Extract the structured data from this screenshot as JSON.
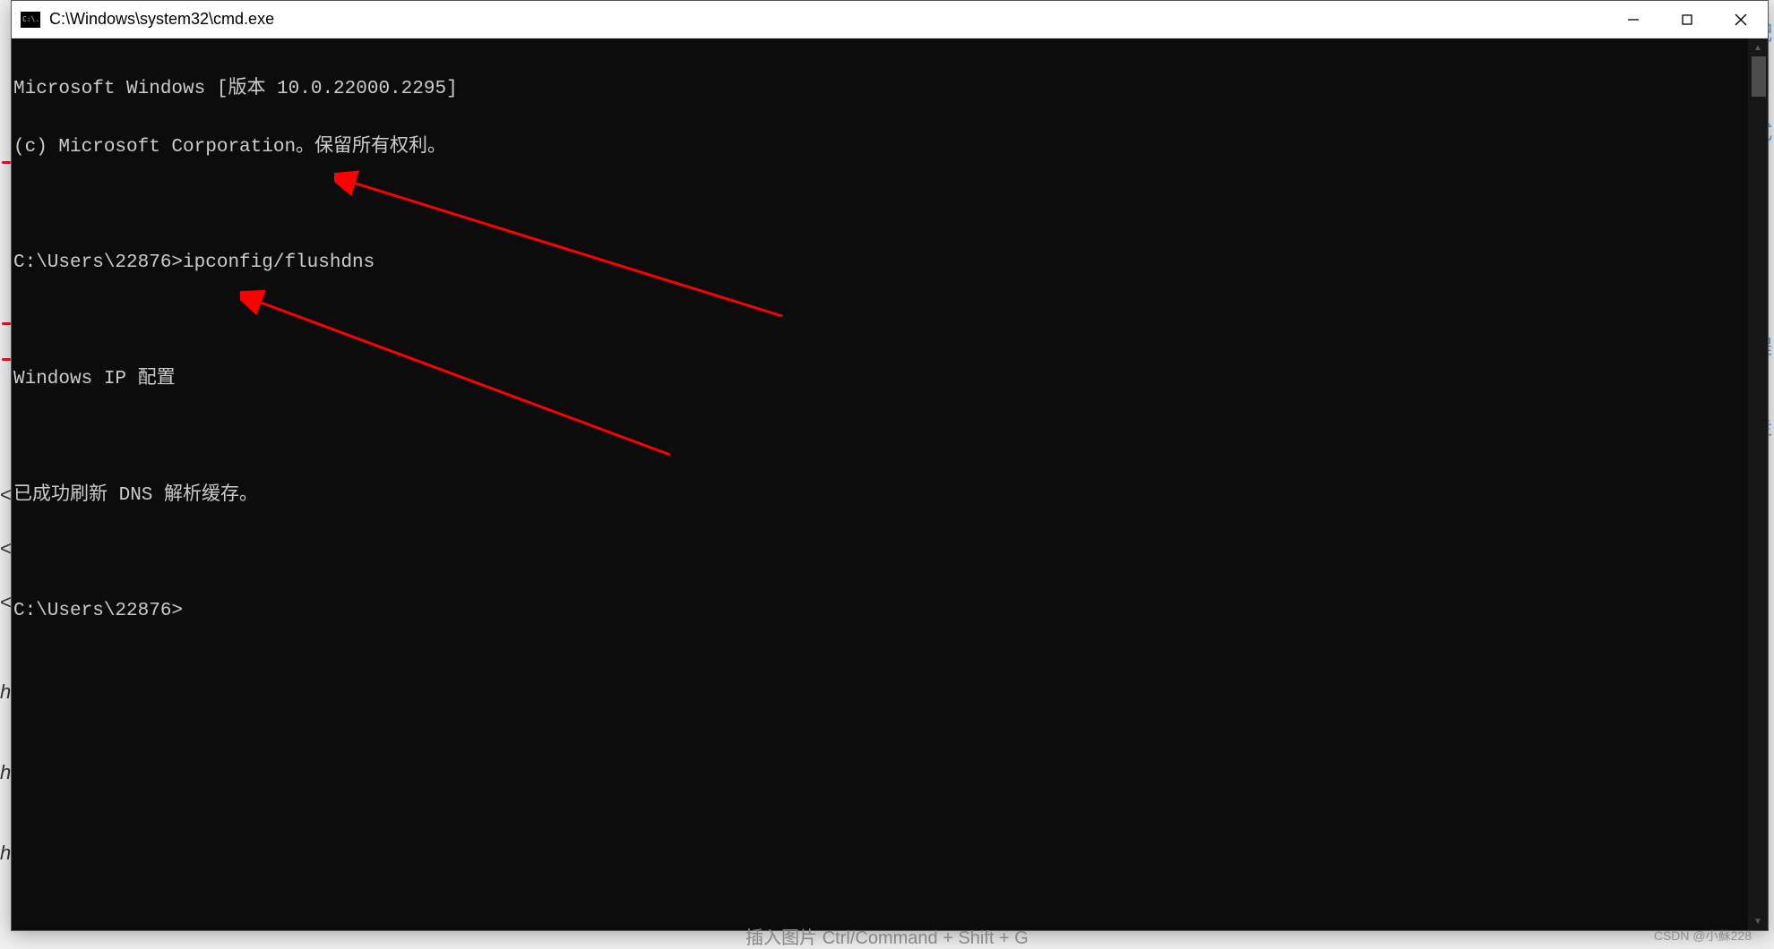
{
  "window": {
    "title": "C:\\Windows\\system32\\cmd.exe",
    "icon_text": "C:\\."
  },
  "terminal": {
    "lines": [
      "Microsoft Windows [版本 10.0.22000.2295]",
      "(c) Microsoft Corporation。保留所有权利。",
      "",
      "C:\\Users\\22876>ipconfig/flushdns",
      "",
      "Windows IP 配置",
      "",
      "已成功刷新 DNS 解析缓存。",
      "",
      "C:\\Users\\22876>"
    ]
  },
  "background": {
    "chars_right": [
      "配",
      "式",
      "程",
      "走"
    ],
    "chars_left": [
      "<",
      "<",
      "<",
      "ha",
      "ha",
      "ha"
    ],
    "bottom_hint": "插入图片    Ctrl/Command  +  Shift  +  G"
  },
  "watermark": "CSDN @小蘇228",
  "annotation": {
    "color": "#ff0000"
  }
}
